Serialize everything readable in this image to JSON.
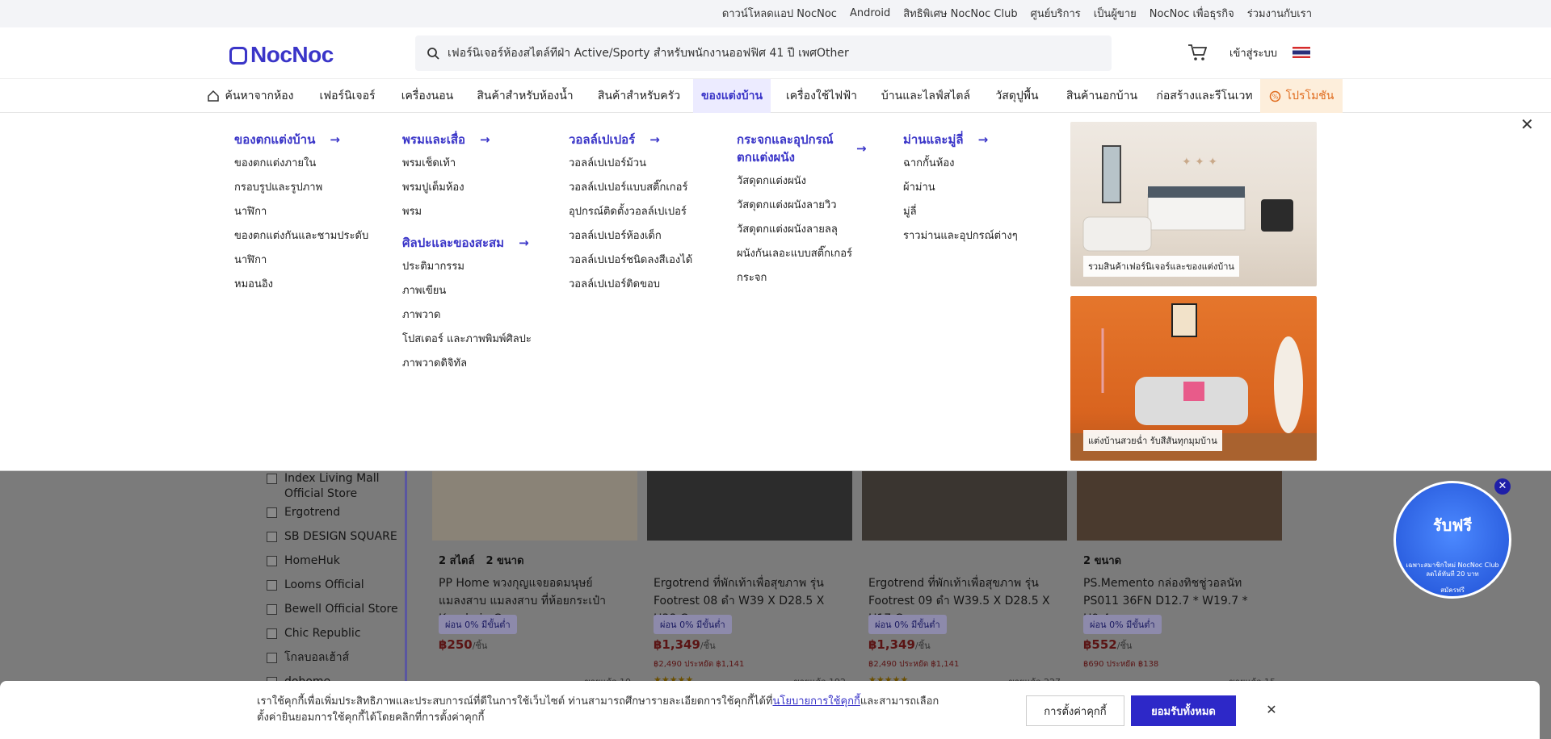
{
  "topbar": {
    "links": [
      "ดาวน์โหลดแอป NocNoc",
      "Android",
      "สิทธิพิเศษ NocNoc Club",
      "ศูนย์บริการ",
      "เป็นผู้ขาย",
      "NocNoc เพื่อธุรกิจ",
      "ร่วมงานกับเรา"
    ]
  },
  "header": {
    "logo": "NocNoc",
    "search_value": "เฟอร์นิเจอร์ห้องสไตล์ทีฝ่า Active/Sporty สำหรับพนักงานออฟฟิศ 41 ปี เพศOther",
    "login_label": "เข้าสู่ระบบ"
  },
  "nav": {
    "items": [
      "ค้นหาจากห้อง",
      "เฟอร์นิเจอร์",
      "เครื่องนอน",
      "สินค้าสำหรับห้องน้ำ",
      "สินค้าสำหรับครัว",
      "ของแต่งบ้าน",
      "เครื่องใช้ไฟฟ้า",
      "บ้านและไลฟ์สไตล์",
      "วัสดุปูพื้น",
      "สินค้านอกบ้าน",
      "ก่อสร้างและรีโนเวท",
      "โปรโมชัน"
    ]
  },
  "mega": {
    "col1": {
      "title": "ของตกแต่งบ้าน",
      "items": [
        "ของตกแต่งภายใน",
        "กรอบรูปและรูปภาพ",
        "นาฬิกา",
        "ของตกแต่งกันและชามประดับ",
        "นาฬิกา",
        "หมอนอิง"
      ]
    },
    "col2": {
      "title": "พรมและเสื่อ",
      "items": [
        "พรมเช็ดเท้า",
        "พรมปูเต็มห้อง",
        "พรม"
      ],
      "title2": "ศิลปะและของสะสม",
      "items2": [
        "ประติมากรรม",
        "ภาพเขียน",
        "ภาพวาด",
        "โปสเตอร์ และภาพพิมพ์ศิลปะ",
        "ภาพวาดดิจิทัล"
      ]
    },
    "col3": {
      "title": "วอลล์เปเปอร์",
      "items": [
        "วอลล์เปเปอร์ม้วน",
        "วอลล์เปเปอร์แบบสติ๊กเกอร์",
        "อุปกรณ์ติดตั้งวอลล์เปเปอร์",
        "วอลล์เปเปอร์ห้องเด็ก",
        "วอลล์เปเปอร์ชนิดลงสีเองได้",
        "วอลล์เปเปอร์ติดขอบ"
      ]
    },
    "col4": {
      "title": "กระจกและอุปกรณ์ตกแต่งผนัง",
      "items": [
        "วัสดุตกแต่งผนัง",
        "วัสดุตกแต่งผนังลายวิว",
        "วัสดุตกแต่งผนังลายลลุ",
        "ผนังกันเลอะแบบสติ๊กเกอร์",
        "กระจก"
      ]
    },
    "col5": {
      "title": "ม่านและมู่ลี่",
      "items": [
        "ฉากกั้นห้อง",
        "ผ้าม่าน",
        "มู่ลี่",
        "ราวม่านและอุปกรณ์ต่างๆ"
      ]
    },
    "promo1": "รวมสินค้าเฟอร์นิเจอร์และของแต่งบ้าน",
    "promo2": "แต่งบ้านสวยฉ่ำ รับสีสันทุกมุมบ้าน"
  },
  "filters": [
    "Index Living Mall Official Store",
    "Ergotrend",
    "SB DESIGN SQUARE",
    "HomeHuk",
    "Looms Official",
    "Bewell Official Store",
    "Chic Republic",
    "โกลบอลเฮ้าส์",
    "dohome"
  ],
  "products": [
    {
      "tags": [
        "2 สไตล์",
        "2 ขนาด"
      ],
      "name": "PP Home พวงกุญแจยอดมนุษย์แมลงสาบ แมลงสาบ ที่ห้อยกระเป๋า Keychain C...",
      "badge": "ผ่อน 0% มีขั้นต่ำ",
      "price": "฿250",
      "unit": "/ชิ้น",
      "orig": "",
      "sold": "ขายแล้ว 10",
      "stars": ""
    },
    {
      "tags": [],
      "name": "Ergotrend ที่พักเท้าเพื่อสุขภาพ รุ่น Footrest 08 ดำ W39 X D28.5 X H38 Cm.",
      "badge": "ผ่อน 0% มีขั้นต่ำ",
      "price": "฿1,349",
      "unit": "/ชิ้น",
      "orig": "฿2,490 ประหยัด ฿1,141",
      "sold": "ขายแล้ว 192",
      "stars": "★★★★★"
    },
    {
      "tags": [],
      "name": "Ergotrend ที่พักเท้าเพื่อสุขภาพ รุ่น Footrest 09 ดำ W39.5 X D28.5 X H17 Cm",
      "badge": "ผ่อน 0% มีขั้นต่ำ",
      "price": "฿1,349",
      "unit": "/ชิ้น",
      "orig": "฿2,490 ประหยัด ฿1,141",
      "sold": "ขายแล้ว 227",
      "stars": "★★★★★"
    },
    {
      "tags": [
        "2 ขนาด"
      ],
      "name": "PS.Memento กล่องทิชชู่วอลนัท PS011 36FN D12.7 * W19.7 * H9.4",
      "badge": "ผ่อน 0% มีขั้นต่ำ",
      "price": "฿552",
      "unit": "/ชิ้น",
      "orig": "฿690 ประหยัด ฿138",
      "sold": "ขายแล้ว 15",
      "stars": ""
    }
  ],
  "freebie": {
    "title": "รับฟรี",
    "line1": "เฉพาะสมาชิกใหม่ NocNoc Club",
    "line2": "ลดได้ทันที 20 บาท",
    "cta": "สมัครฟรี"
  },
  "consent": {
    "text_a": "เราใช้คุกกี้เพื่อเพิ่มประสิทธิภาพและประสบการณ์ที่ดีในการใช้เว็บไซต์ ท่านสามารถศึกษารายละเอียดการใช้คุกกี้ได้ที่",
    "link": "นโยบายการใช้คุกกี้",
    "text_b": "และสามารถเลือกตั้งค่ายินยอมการใช้คุกกี้ได้โดยคลิกที่การตั้งค่าคุกกี้",
    "settings_label": "การตั้งค่าคุกกี้",
    "accept_label": "ยอมรับทั้งหมด"
  }
}
